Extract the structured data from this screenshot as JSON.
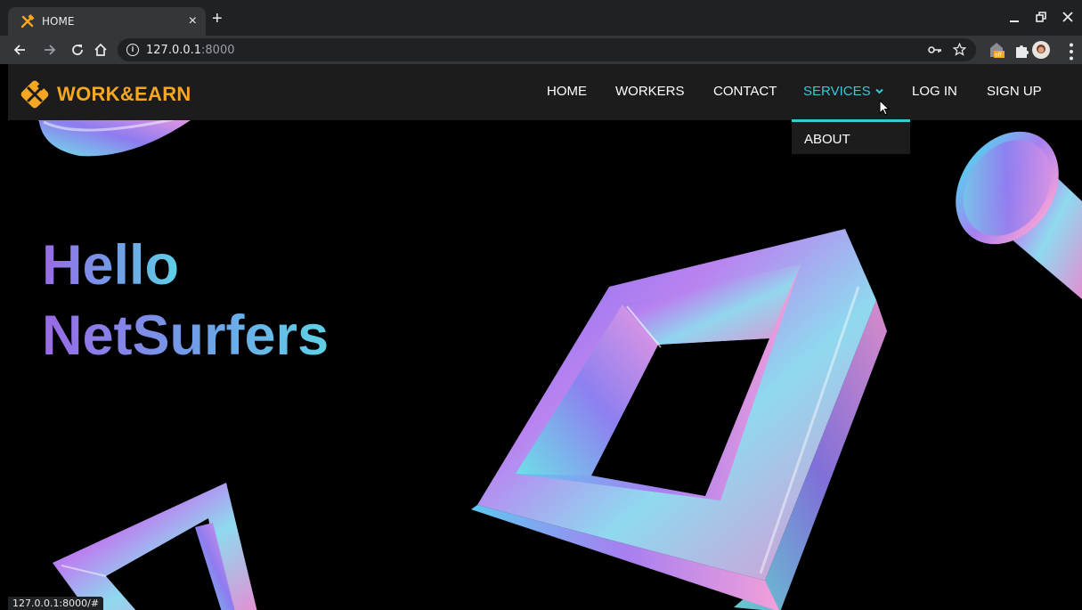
{
  "browser": {
    "tab_title": "HOME",
    "new_tab": "+",
    "close_tab": "×",
    "url_host": "127.0.0.1",
    "url_port": ":8000",
    "status_url": "127.0.0.1:8000/#",
    "ext_badge": "off"
  },
  "site": {
    "brand": "WORK&EARN",
    "nav": {
      "home": "HOME",
      "workers": "WORKERS",
      "contact": "CONTACT",
      "services": "SERVICES",
      "login": "LOG IN",
      "signup": "SIGN UP"
    },
    "dropdown": {
      "about": "ABOUT"
    },
    "hero": {
      "line1": "Hello",
      "line2": "NetSurfers"
    }
  },
  "colors": {
    "brand": "#f5a623",
    "accent": "#39c7d8",
    "navbar_bg": "#1c1c1c",
    "page_bg": "#000000"
  },
  "icons": {
    "favicon": "tools-icon",
    "back": "arrow-left-icon",
    "forward": "arrow-right-icon",
    "reload": "reload-icon",
    "home": "home-icon",
    "site_info": "info-icon",
    "key": "key-icon",
    "bookmark": "star-icon",
    "extension": "puzzle-icon",
    "profile": "avatar",
    "menu": "kebab-menu-icon"
  }
}
